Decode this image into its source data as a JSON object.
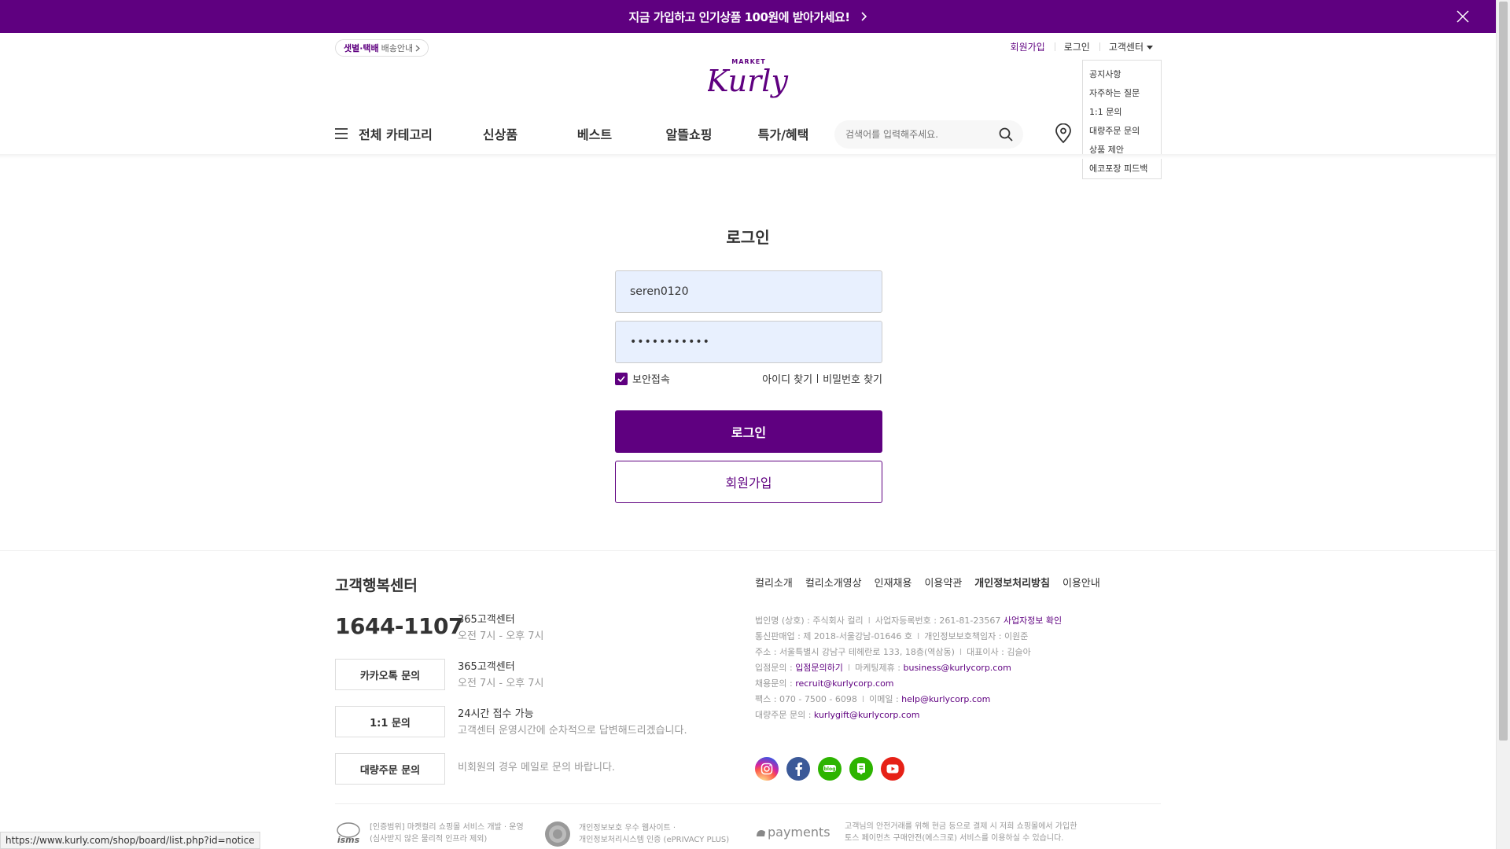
{
  "banner": {
    "text": "지금 가입하고 인기상품 100원에 받아가세요!"
  },
  "header": {
    "delivery_badge_strong": "샛별·택배",
    "delivery_badge_label": "배송안내",
    "top_links": {
      "signup": "회원가입",
      "login": "로그인",
      "customer_center": "고객센터"
    },
    "cs_dropdown": [
      "공지사항",
      "자주하는 질문",
      "1:1 문의",
      "대량주문 문의",
      "상품 제안",
      "에코포장 피드백"
    ],
    "logo_top": "MARKET",
    "logo_main": "Kurly",
    "nav": {
      "all_categories": "전체 카테고리",
      "items": [
        "신상품",
        "베스트",
        "알뜰쇼핑",
        "특가/혜택"
      ]
    },
    "search_placeholder": "검색어를 입력해주세요."
  },
  "login": {
    "title": "로그인",
    "id_value": "seren0120",
    "password_value": "•••••••••••",
    "secure_login_label": "보안접속",
    "secure_login_checked": true,
    "find_id": "아이디 찾기",
    "find_password": "비밀번호 찾기",
    "login_button": "로그인",
    "signup_button": "회원가입"
  },
  "footer": {
    "cs_title": "고객행복센터",
    "phone": "1644-1107",
    "phone_title": "365고객센터",
    "phone_hours": "오전 7시 - 오후 7시",
    "kakao_button": "카카오톡 문의",
    "kakao_title": "365고객센터",
    "kakao_hours": "오전 7시 - 오후 7시",
    "inquiry_button": "1:1 문의",
    "inquiry_title": "24시간 접수 가능",
    "inquiry_desc": "고객센터 운영시간에 순차적으로 답변해드리겠습니다.",
    "bulk_button": "대량주문 문의",
    "bulk_desc": "비회원의 경우 메일로 문의 바랍니다.",
    "nav": [
      "컬리소개",
      "컬리소개영상",
      "인재채용",
      "이용약관",
      "개인정보처리방침",
      "이용안내"
    ],
    "company": {
      "line1_a": "법인명 (상호) : 주식회사 컬리",
      "line1_b": "사업자등록번호 : 261-81-23567",
      "line1_link": "사업자정보 확인",
      "line2_a": "통신판매업 : 제 2018-서울강남-01646 호",
      "line2_b": "개인정보보호책임자 : 이원준",
      "line3_a": "주소 : 서울특별시 강남구 테헤란로 133, 18층(역삼동)",
      "line3_b": "대표이사 : 김슬아",
      "line4_label": "입점문의 :",
      "line4_link": "입점문의하기",
      "line4_b_label": "마케팅제휴 :",
      "line4_b_link": "business@kurlycorp.com",
      "line5_label": "채용문의 :",
      "line5_link": "recruit@kurlycorp.com",
      "line6_a": "팩스 : 070 - 7500 - 6098",
      "line6_b_label": "이메일 :",
      "line6_b_link": "help@kurlycorp.com",
      "line7_label": "대량주문 문의 :",
      "line7_link": "kurlygift@kurlycorp.com"
    },
    "sns": [
      "instagram-icon",
      "facebook-icon",
      "blog-icon",
      "naver-post-icon",
      "youtube-icon"
    ],
    "certs": {
      "isms_line1": "[인증범위] 마켓컬리 쇼핑몰 서비스 개발 · 운영",
      "isms_line2": "(심사받지 않은 물리적 인프라 제외)",
      "isms_logo": "isms",
      "privacy_line1": "개인정보보호 우수 웹사이트 ·",
      "privacy_line2": "개인정보처리시스템 인증 (ePRIVACY PLUS)",
      "payments_logo": "payments",
      "payments_line1": "고객님의 안전거래를 위해 현금 등으로 결제 시 저희 쇼핑몰에서 가입한",
      "payments_line2": "토스 페이먼츠 구매안전(에스크로) 서비스를 이용하실 수 있습니다."
    }
  },
  "status_url": "https://www.kurly.com/shop/board/list.php?id=notice",
  "colors": {
    "brand": "#5f0080",
    "autofill": "#e8f0fe"
  }
}
